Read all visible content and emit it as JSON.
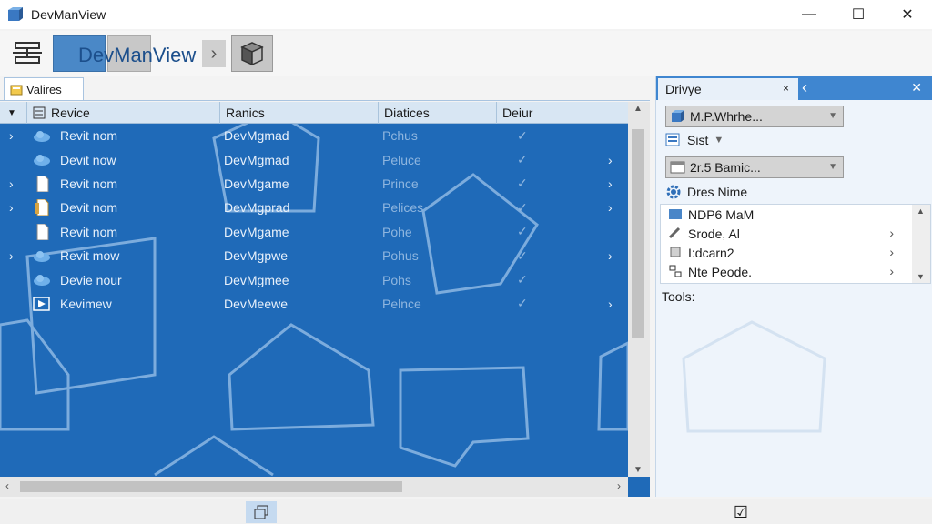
{
  "window": {
    "title": "DevManView",
    "controls": {
      "minimize": "—",
      "maximize": "☐",
      "close": "✕"
    }
  },
  "toolbar": {
    "app_label": "DevManView",
    "arrow": "›"
  },
  "left_tab": {
    "label": "Valires"
  },
  "columns": [
    "Revice",
    "Ranics",
    "Diatices",
    "Deiur"
  ],
  "rows": [
    {
      "expander": "›",
      "name": "Revit nom",
      "driver": "DevMgmad",
      "status": "Pchus",
      "check": "✓",
      "arrow": ""
    },
    {
      "expander": "",
      "name": "Devit now",
      "driver": "DevMgmad",
      "status": "Peluce",
      "check": "✓",
      "arrow": "›"
    },
    {
      "expander": "›",
      "name": "Revit nom",
      "driver": "DevMgame",
      "status": "Prince",
      "check": "✓",
      "arrow": "›"
    },
    {
      "expander": "›",
      "name": "Devit nom",
      "driver": "DevMgprad",
      "status": "Pelices",
      "check": "✓",
      "arrow": "›"
    },
    {
      "expander": "",
      "name": "Revit nom",
      "driver": "DevMgame",
      "status": "Pohe",
      "check": "✓",
      "arrow": ""
    },
    {
      "expander": "›",
      "name": "Revit mow",
      "driver": "DevMgpwe",
      "status": "Pohus",
      "check": "✓",
      "arrow": "›"
    },
    {
      "expander": "",
      "name": "Devie nour",
      "driver": "DevMgmee",
      "status": "Pohs",
      "check": "✓",
      "arrow": ""
    },
    {
      "expander": "",
      "name": "Kevimew",
      "driver": "DevMeewe",
      "status": "Pelnce",
      "check": "✓",
      "arrow": "›"
    }
  ],
  "right_panel": {
    "tab_label": "Drivye",
    "tab_close": "×",
    "back": "‹",
    "panel_close": "✕",
    "dropdown1": "M.P.Whrhe...",
    "sist_label": "Sist",
    "sist_arrow": "▼",
    "dropdown2": "2r.5 Bamic...",
    "dres_label": "Dres Nime",
    "list_items": [
      {
        "label": "NDP6 MaM",
        "chev": ""
      },
      {
        "label": "Srode, Al",
        "chev": "›"
      },
      {
        "label": "I:dcarn2",
        "chev": "›"
      },
      {
        "label": "Nte Peode.",
        "chev": "›"
      }
    ],
    "tools_label": "Tools:"
  },
  "status": {
    "check_glyph": "☑"
  },
  "colors": {
    "list_bg": "#1f6ab8",
    "accent": "#3f86d0"
  }
}
